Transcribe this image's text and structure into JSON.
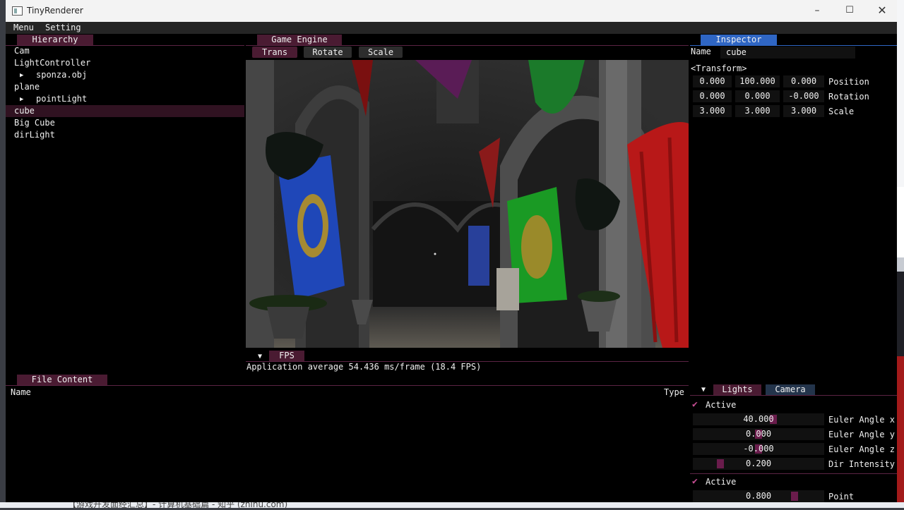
{
  "window": {
    "title": "TinyRenderer"
  },
  "menu": {
    "items": [
      "Menu",
      "Setting"
    ]
  },
  "hierarchy": {
    "tab": "Hierarchy",
    "items": [
      "Cam",
      "LightController",
      "sponza.obj",
      "plane",
      "pointLight",
      "cube",
      "Big Cube",
      "dirLight"
    ]
  },
  "engine": {
    "tab": "Game Engine",
    "tools": {
      "trans": "Trans",
      "rotate": "Rotate",
      "scale": "Scale"
    },
    "fps_tab": "FPS",
    "fps_text": "Application average 54.436 ms/frame (18.4 FPS)"
  },
  "file": {
    "tab": "File Content",
    "col_name": "Name",
    "col_type": "Type"
  },
  "inspector": {
    "tab": "Inspector",
    "name_label": "Name",
    "name_value": "cube",
    "transform_header": "<Transform>",
    "position": {
      "x": "0.000",
      "y": "100.000",
      "z": "0.000",
      "label": "Position"
    },
    "rotation": {
      "x": "0.000",
      "y": "0.000",
      "z": "-0.000",
      "label": "Rotation"
    },
    "scale": {
      "x": "3.000",
      "y": "3.000",
      "z": "3.000",
      "label": "Scale"
    }
  },
  "lights": {
    "tab_lights": "Lights",
    "tab_camera": "Camera",
    "dir": {
      "active": "Active",
      "euler_x": {
        "value": "40.000",
        "label": "Euler Angle x",
        "level": 0.6
      },
      "euler_y": {
        "value": "0.000",
        "label": "Euler Angle y",
        "level": 0.5
      },
      "euler_z": {
        "value": "-0.000",
        "label": "Euler Angle z",
        "level": 0.5
      },
      "intensity": {
        "value": "0.200",
        "label": "Dir Intensity",
        "level": 0.2
      }
    },
    "point": {
      "active": "Active",
      "intensity": {
        "value": "0.800",
        "label": "Point Intensit",
        "level": 0.8
      }
    }
  },
  "desktop": {
    "behind_text": "【游戏开发面经汇总】- 计算机基础篇 - 知乎 (zhihu.com)"
  },
  "colors": {
    "accent": "#5b2444",
    "inspector_tab": "#2f66c4",
    "check": "#c44d92"
  }
}
